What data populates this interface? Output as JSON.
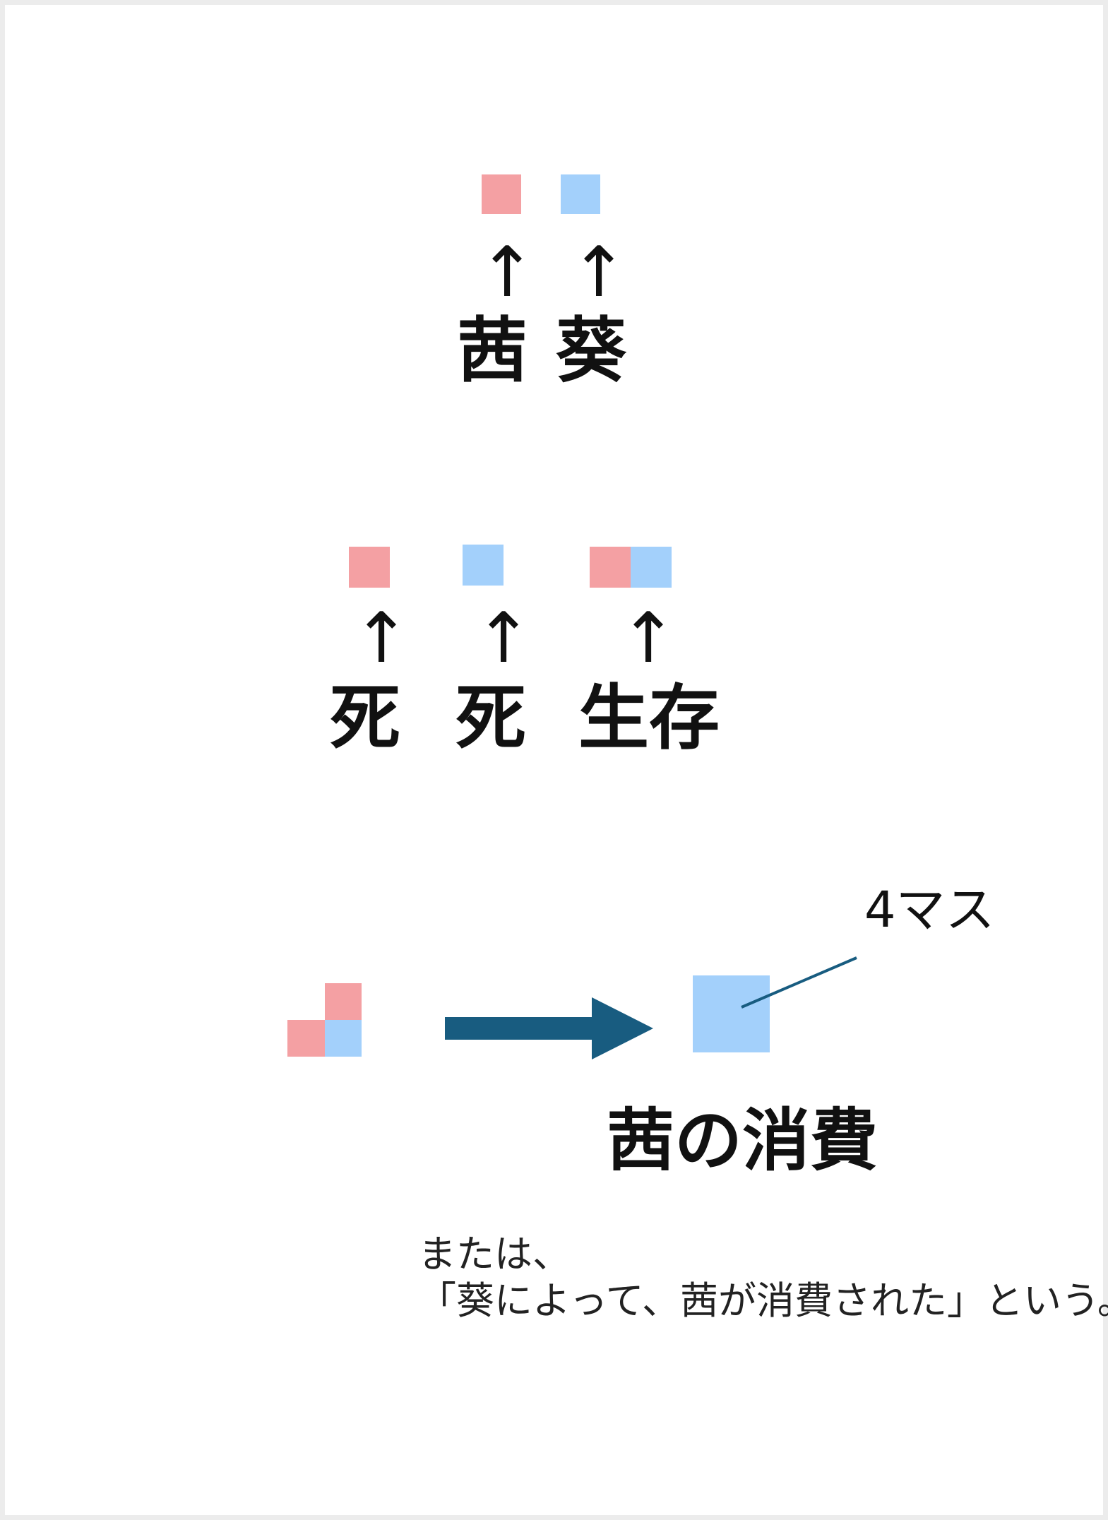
{
  "colors": {
    "pink": "#f4a0a3",
    "blue": "#a3d0fb",
    "arrow": "#185c80",
    "text": "#111111"
  },
  "section1": {
    "labels": [
      "茜",
      "葵"
    ]
  },
  "section2": {
    "labels": [
      "死",
      "死",
      "生存"
    ]
  },
  "section3": {
    "annotation": "4マス",
    "result_label": "茜の消費",
    "note_line1": "または、",
    "note_line2": "「葵によって、茜が消費された」という。"
  }
}
